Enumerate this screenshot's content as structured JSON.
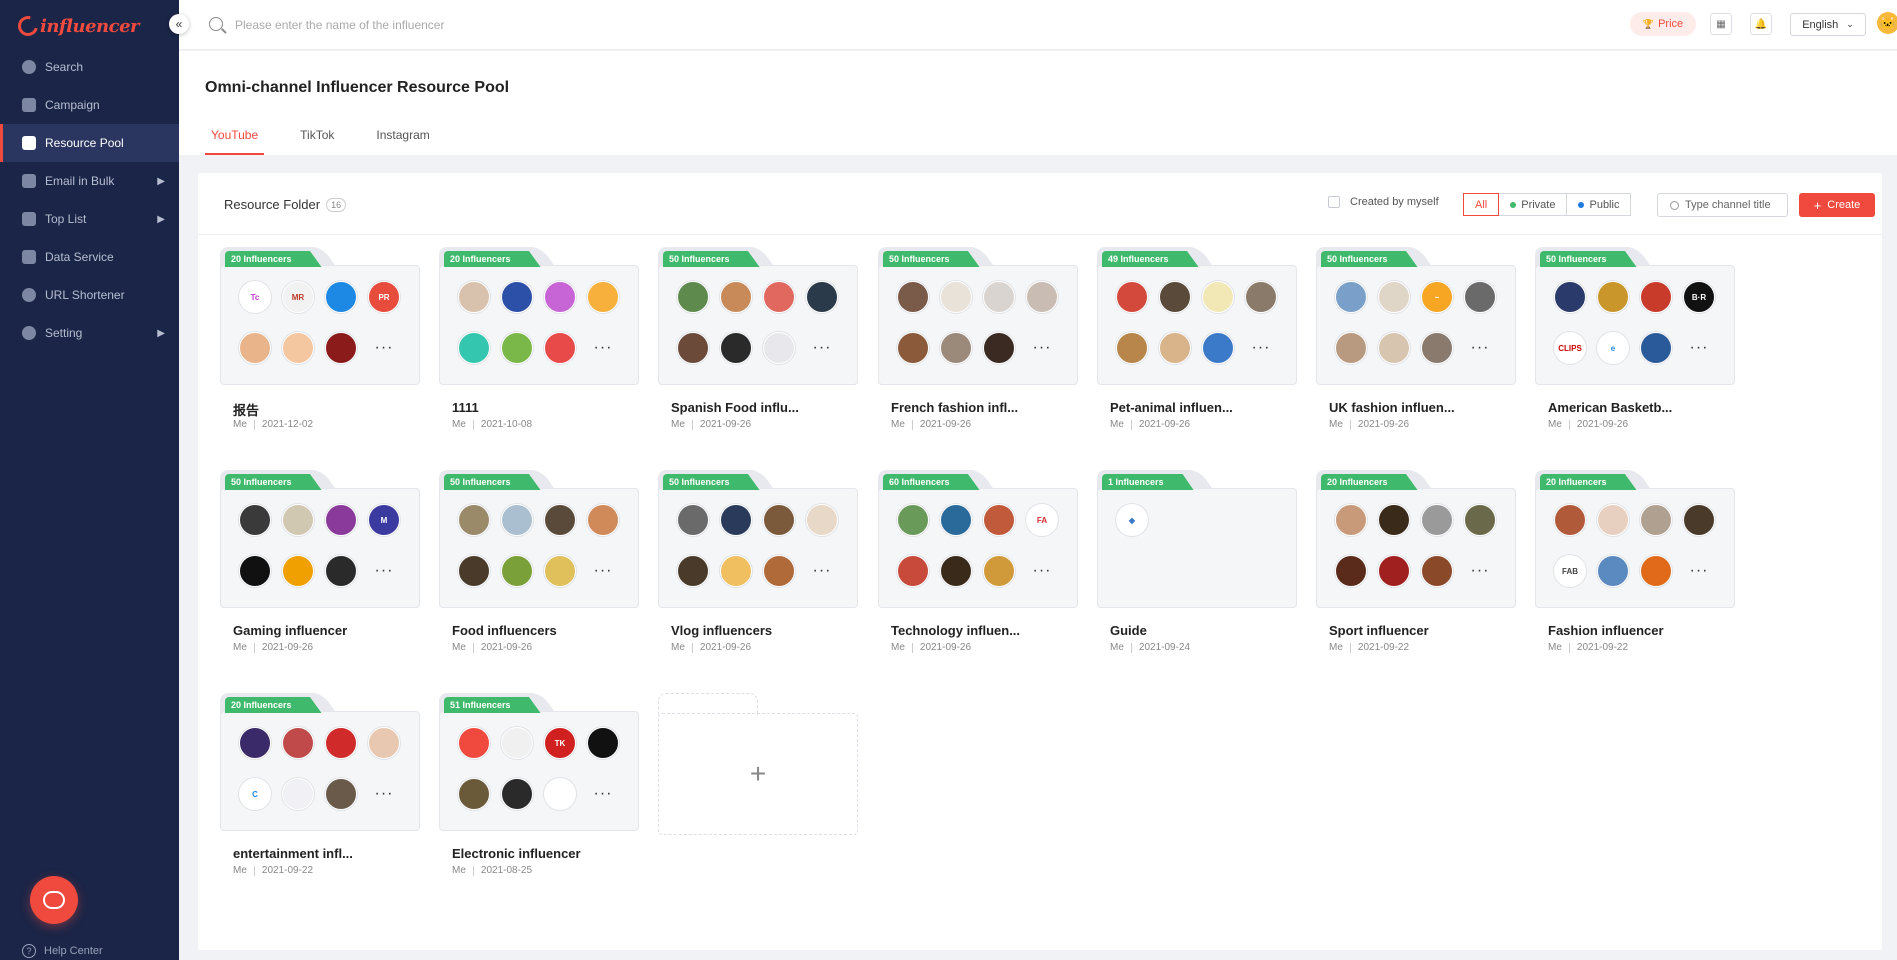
{
  "app": {
    "logo_text": "influencer"
  },
  "sidebar": {
    "items": [
      {
        "label": "Search",
        "icon": "compass-icon"
      },
      {
        "label": "Campaign",
        "icon": "clipboard-icon"
      },
      {
        "label": "Resource Pool",
        "icon": "heart-icon",
        "active": true
      },
      {
        "label": "Email in Bulk",
        "icon": "mail-icon",
        "arrow": "▶"
      },
      {
        "label": "Top List",
        "icon": "bar-chart-icon",
        "arrow": "▶"
      },
      {
        "label": "Data Service",
        "icon": "line-chart-icon"
      },
      {
        "label": "URL Shortener",
        "icon": "link-icon"
      },
      {
        "label": "Setting",
        "icon": "gear-icon",
        "arrow": "▶"
      }
    ],
    "help_label": "Help Center"
  },
  "topbar": {
    "search_placeholder": "Please enter the name of the influencer",
    "price_label": "Price",
    "language": "English"
  },
  "page": {
    "title": "Omni-channel Influencer Resource Pool",
    "tabs": [
      "YouTube",
      "TikTok",
      "Instagram"
    ],
    "active_tab": "YouTube"
  },
  "toolbar": {
    "folder_label": "Resource Folder",
    "folder_count": "16",
    "created_by_myself": "Created by myself",
    "filter_all": "All",
    "filter_private": "Private",
    "filter_public": "Public",
    "channel_placeholder": "Type channel title",
    "create_label": "Create",
    "colors": {
      "accent": "#f04a3e",
      "private_dot": "#3fb96b",
      "public_dot": "#1f7ae0",
      "badge": "#3fb96b"
    }
  },
  "folders": [
    {
      "badge": "20 Influencers",
      "name": "报告",
      "owner": "Me",
      "date": "2021-12-02",
      "avatars": [
        [
          "Tc",
          "#ffffff",
          "#c23bd4"
        ],
        [
          "MR",
          "#f2f2f2",
          "#c0392b"
        ],
        [
          "",
          "#1e88e5",
          "#1e88e5"
        ],
        [
          "PR",
          "#e74c3c",
          "#fff"
        ],
        [
          "",
          "#e9b48a",
          "#e9b48a"
        ],
        [
          "",
          "#f4c7a1",
          "#d44"
        ],
        [
          "",
          "#8b1a1a",
          "#8b1a1a"
        ]
      ]
    },
    {
      "badge": "20 Influencers",
      "name": "1111",
      "owner": "Me",
      "date": "2021-10-08",
      "avatars": [
        [
          "",
          "#d9c2ad",
          "#333"
        ],
        [
          "",
          "#2c4fa8",
          "#2c4fa8"
        ],
        [
          "",
          "#c865d6",
          "#c865d6"
        ],
        [
          "",
          "#f6b03b",
          "#f6b03b"
        ],
        [
          "",
          "#35c6b0",
          "#35c6b0"
        ],
        [
          "",
          "#7bb84a",
          "#7bb84a"
        ],
        [
          "",
          "#e84a4a",
          "#e84a4a"
        ]
      ]
    },
    {
      "badge": "50 Influencers",
      "name": "Spanish Food influ...",
      "owner": "Me",
      "date": "2021-09-26",
      "avatars": [
        [
          "",
          "#5e8a4e",
          "#5e8a4e"
        ],
        [
          "",
          "#c98a5a",
          "#c98a5a"
        ],
        [
          "",
          "#e0685e",
          "#e0685e"
        ],
        [
          "",
          "#2b3a4a",
          "#2b3a4a"
        ],
        [
          "",
          "#6b4a3a",
          "#6b4a3a"
        ],
        [
          "",
          "#2a2a2a",
          "#2a2a2a"
        ],
        [
          "",
          "#e8e8ec",
          "#666"
        ]
      ]
    },
    {
      "badge": "50 Influencers",
      "name": "French fashion infl...",
      "owner": "Me",
      "date": "2021-09-26",
      "avatars": [
        [
          "",
          "#7a5a48",
          "#7a5a48"
        ],
        [
          "",
          "#e8e2d8",
          "#c00"
        ],
        [
          "",
          "#d9d4cf",
          "#d9d4cf"
        ],
        [
          "",
          "#c9bcb2",
          "#c9bcb2"
        ],
        [
          "",
          "#8a5a3a",
          "#8a5a3a"
        ],
        [
          "",
          "#9b8a7a",
          "#9b8a7a"
        ],
        [
          "",
          "#3a2a22",
          "#3a2a22"
        ]
      ]
    },
    {
      "badge": "49 Influencers",
      "name": "Pet-animal influen...",
      "owner": "Me",
      "date": "2021-09-26",
      "avatars": [
        [
          "",
          "#d34a3c",
          "#d34a3c"
        ],
        [
          "",
          "#5a4a3a",
          "#5a4a3a"
        ],
        [
          "",
          "#f2e8b5",
          "#c9a200"
        ],
        [
          "",
          "#8a7a6a",
          "#8a7a6a"
        ],
        [
          "",
          "#b8864a",
          "#b8864a"
        ],
        [
          "",
          "#d9b38a",
          "#d9b38a"
        ],
        [
          "",
          "#3a7ac9",
          "#3a7ac9"
        ]
      ]
    },
    {
      "badge": "50 Influencers",
      "name": "UK fashion influen...",
      "owner": "Me",
      "date": "2021-09-26",
      "avatars": [
        [
          "",
          "#7aa0c9",
          "#7aa0c9"
        ],
        [
          "",
          "#e0d6c8",
          "#e0d6c8"
        ],
        [
          "~",
          "#f6a623",
          "#fff"
        ],
        [
          "",
          "#6a6a6a",
          "#6a6a6a"
        ],
        [
          "",
          "#b89a80",
          "#b89a80"
        ],
        [
          "",
          "#d8c5b0",
          "#d8c5b0"
        ],
        [
          "",
          "#8a7a6e",
          "#8a7a6e"
        ]
      ]
    },
    {
      "badge": "50 Influencers",
      "name": "American Basketb...",
      "owner": "Me",
      "date": "2021-09-26",
      "avatars": [
        [
          "",
          "#2a3a6a",
          "#2a3a6a"
        ],
        [
          "",
          "#c8962a",
          "#c8962a"
        ],
        [
          "",
          "#c83a2a",
          "#c83a2a"
        ],
        [
          "B·R",
          "#111",
          "#fff"
        ],
        [
          "CLIPS",
          "#fff",
          "#c00"
        ],
        [
          "e",
          "#fff",
          "#1e88e5"
        ],
        [
          "",
          "#2a5a9a",
          "#2a5a9a"
        ]
      ]
    },
    {
      "badge": "50 Influencers",
      "name": "Gaming influencer",
      "owner": "Me",
      "date": "2021-09-26",
      "avatars": [
        [
          "",
          "#3a3a3a",
          "#3a3a3a"
        ],
        [
          "",
          "#d0c8b0",
          "#d0c8b0"
        ],
        [
          "",
          "#8a3a9a",
          "#8a3a9a"
        ],
        [
          "M",
          "#3a3aa0",
          "#fff"
        ],
        [
          "",
          "#111",
          "#111"
        ],
        [
          "",
          "#f0a000",
          "#f0a000"
        ],
        [
          "",
          "#2a2a2a",
          "#2a2a2a"
        ]
      ]
    },
    {
      "badge": "50 Influencers",
      "name": "Food influencers",
      "owner": "Me",
      "date": "2021-09-26",
      "avatars": [
        [
          "",
          "#9a8a6a",
          "#9a8a6a"
        ],
        [
          "",
          "#aac0d0",
          "#aac0d0"
        ],
        [
          "",
          "#5a4a3a",
          "#5a4a3a"
        ],
        [
          "",
          "#d08a5a",
          "#d08a5a"
        ],
        [
          "",
          "#4a3a2a",
          "#4a3a2a"
        ],
        [
          "",
          "#7aa03a",
          "#7aa03a"
        ],
        [
          "",
          "#e0c05a",
          "#e0c05a"
        ]
      ]
    },
    {
      "badge": "50 Influencers",
      "name": "Vlog influencers",
      "owner": "Me",
      "date": "2021-09-26",
      "avatars": [
        [
          "",
          "#6a6a6a",
          "#6a6a6a"
        ],
        [
          "",
          "#2a3a5a",
          "#2a3a5a"
        ],
        [
          "",
          "#7a5a3a",
          "#7a5a3a"
        ],
        [
          "",
          "#e8d8c8",
          "#e8d8c8"
        ],
        [
          "",
          "#4a3a2a",
          "#4a3a2a"
        ],
        [
          "",
          "#f0c060",
          "#f0c060"
        ],
        [
          "",
          "#b06a3a",
          "#b06a3a"
        ]
      ]
    },
    {
      "badge": "60 Influencers",
      "name": "Technology influen...",
      "owner": "Me",
      "date": "2021-09-26",
      "avatars": [
        [
          "",
          "#6a9a5a",
          "#6a9a5a"
        ],
        [
          "",
          "#2a6a9a",
          "#2a6a9a"
        ],
        [
          "",
          "#c05a3a",
          "#c05a3a"
        ],
        [
          "FA",
          "#fff",
          "#d03030"
        ],
        [
          "",
          "#c84a3a",
          "#c84a3a"
        ],
        [
          "",
          "#3a2a1a",
          "#3a2a1a"
        ],
        [
          "",
          "#d09a3a",
          "#d09a3a"
        ]
      ]
    },
    {
      "badge": "1 Influencers",
      "name": "Guide",
      "owner": "Me",
      "date": "2021-09-24",
      "avatars": [
        [
          "◆",
          "#fff",
          "#3a7ac9"
        ]
      ]
    },
    {
      "badge": "20 Influencers",
      "name": "Sport influencer",
      "owner": "Me",
      "date": "2021-09-22",
      "avatars": [
        [
          "",
          "#c89a7a",
          "#c89a7a"
        ],
        [
          "",
          "#3a2a1a",
          "#3a2a1a"
        ],
        [
          "",
          "#9a9a9a",
          "#9a9a9a"
        ],
        [
          "",
          "#6a6a4a",
          "#6a6a4a"
        ],
        [
          "",
          "#5a2a1a",
          "#5a2a1a"
        ],
        [
          "",
          "#a02020",
          "#a02020"
        ],
        [
          "",
          "#8a4a2a",
          "#8a4a2a"
        ]
      ]
    },
    {
      "badge": "20 Influencers",
      "name": "Fashion influencer",
      "owner": "Me",
      "date": "2021-09-22",
      "avatars": [
        [
          "",
          "#b05a3a",
          "#b05a3a"
        ],
        [
          "",
          "#e8d0c0",
          "#e8d0c0"
        ],
        [
          "",
          "#b0a090",
          "#b0a090"
        ],
        [
          "",
          "#4a3a2a",
          "#4a3a2a"
        ],
        [
          "FAB",
          "#fff",
          "#444"
        ],
        [
          "",
          "#5a8ac0",
          "#5a8ac0"
        ],
        [
          "",
          "#e06a1a",
          "#e06a1a"
        ]
      ]
    },
    {
      "badge": "20 Influencers",
      "name": "entertainment infl...",
      "owner": "Me",
      "date": "2021-09-22",
      "avatars": [
        [
          "",
          "#3a2a6a",
          "#3a2a6a"
        ],
        [
          "",
          "#c04a4a",
          "#c04a4a"
        ],
        [
          "",
          "#d02a2a",
          "#d02a2a"
        ],
        [
          "",
          "#e8c8b0",
          "#e8c8b0"
        ],
        [
          "C",
          "#fff",
          "#1e88e5"
        ],
        [
          "",
          "#f0f0f5",
          "#666"
        ],
        [
          "",
          "#6a5a4a",
          "#6a5a4a"
        ]
      ]
    },
    {
      "badge": "51 Influencers",
      "name": "Electronic influencer",
      "owner": "Me",
      "date": "2021-08-25",
      "avatars": [
        [
          "",
          "#f04a3e",
          "#f04a3e"
        ],
        [
          "",
          "#f0f0f0",
          "#888"
        ],
        [
          "TK",
          "#d02020",
          "#fff"
        ],
        [
          "",
          "#111",
          "#111"
        ],
        [
          "",
          "#6a5a3a",
          "#6a5a3a"
        ],
        [
          "",
          "#2a2a2a",
          "#2a2a2a"
        ],
        [
          "",
          "#fff",
          "#111"
        ]
      ]
    }
  ]
}
